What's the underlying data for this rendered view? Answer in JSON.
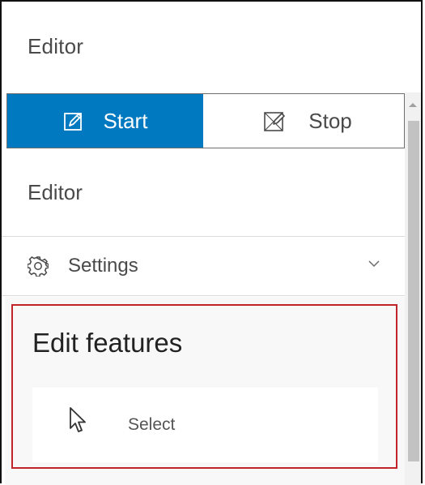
{
  "header": {
    "title": "Editor"
  },
  "toggle": {
    "start_label": "Start",
    "stop_label": "Stop"
  },
  "section": {
    "title": "Editor"
  },
  "settings": {
    "label": "Settings"
  },
  "edit_features": {
    "title": "Edit features",
    "tools": [
      {
        "label": "Select",
        "icon": "cursor-arrow-icon"
      }
    ]
  },
  "icons": {
    "start": "pencil-edit-icon",
    "stop": "stop-edit-icon",
    "settings": "gear-icon",
    "expand": "chevron-down-icon",
    "scroll_up": "scroll-up-arrow-icon"
  },
  "colors": {
    "accent": "#0079c1",
    "highlight": "#c0252b",
    "panel_background": "#f8f8f8"
  }
}
